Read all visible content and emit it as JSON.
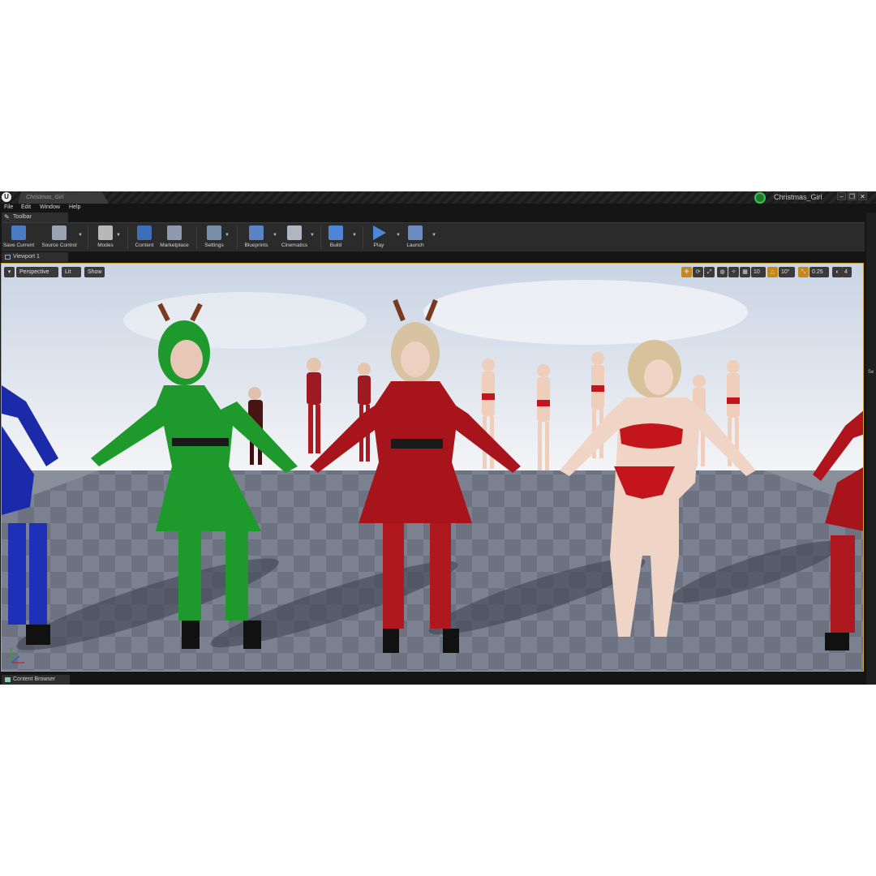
{
  "window": {
    "doc_tab": "Christmas_Girl",
    "project_name": "Christmas_Girl",
    "controls": [
      "–",
      "❐",
      "✕"
    ]
  },
  "menu": [
    "File",
    "Edit",
    "Window",
    "Help"
  ],
  "toolbar": {
    "tab_label": "Toolbar",
    "buttons": [
      {
        "label": "Save Current",
        "icon": "save-icon",
        "color": "#4a7bc4"
      },
      {
        "label": "Source Control",
        "icon": "source-control-icon",
        "color": "#9aa4b0"
      },
      {
        "label": "Modes",
        "icon": "modes-icon",
        "color": "#b8b8b8"
      },
      {
        "label": "Content",
        "icon": "content-icon",
        "color": "#3c6fb8"
      },
      {
        "label": "Marketplace",
        "icon": "marketplace-icon",
        "color": "#8f9ab0"
      },
      {
        "label": "Settings",
        "icon": "settings-icon",
        "color": "#7b8ea8"
      },
      {
        "label": "Blueprints",
        "icon": "blueprints-icon",
        "color": "#5b84c4"
      },
      {
        "label": "Cinematics",
        "icon": "cinematics-icon",
        "color": "#b0b6c0"
      },
      {
        "label": "Build",
        "icon": "build-icon",
        "color": "#4d86d6"
      },
      {
        "label": "Play",
        "icon": "play-icon",
        "color": "#4d86d6"
      },
      {
        "label": "Launch",
        "icon": "launch-icon",
        "color": "#6a8cc0"
      }
    ]
  },
  "viewport": {
    "tab_label": "Viewport 1",
    "perspective": "Perspective",
    "lit": "Lit",
    "show": "Show",
    "grid_snap": "10",
    "rotation_snap": "10°",
    "scale_snap": "0.25",
    "camera_speed": "4",
    "accent_color": "#e0a020"
  },
  "content_browser": {
    "tab_label": "Content Browser"
  },
  "right_panel_label": "Se",
  "scene": {
    "characters": [
      {
        "outfit": "blue dress",
        "color": "#1a2aa8"
      },
      {
        "outfit": "green reindeer dress",
        "color": "#1e9a2c"
      },
      {
        "outfit": "red reindeer dress",
        "color": "#a8141c"
      },
      {
        "outfit": "red bikini",
        "color": "#c4141c"
      },
      {
        "outfit": "red dress (partial)",
        "color": "#b0141c"
      }
    ]
  }
}
